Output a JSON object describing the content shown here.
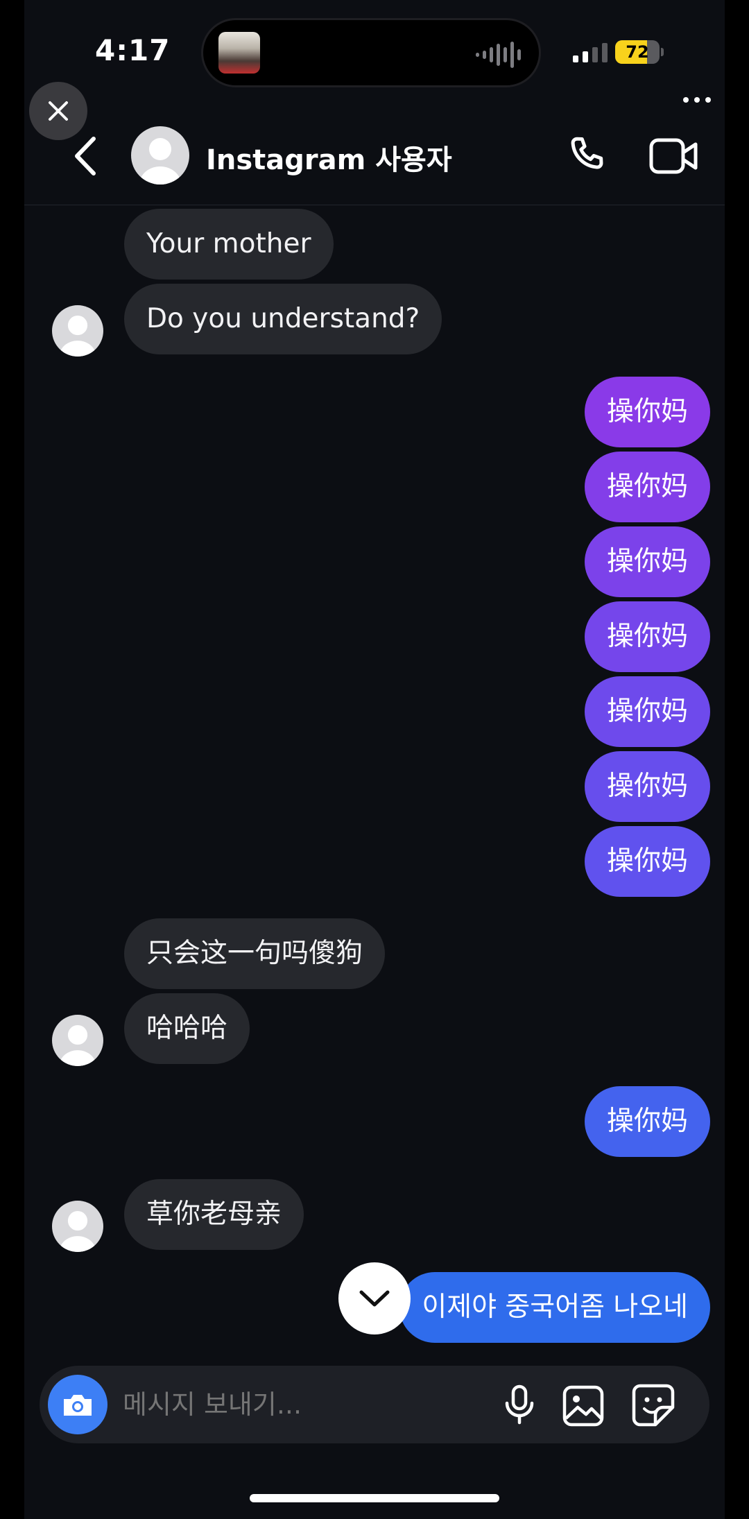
{
  "status_bar": {
    "time": "4:17",
    "battery_level": "72",
    "battery_fraction": 0.72
  },
  "header": {
    "name": "Instagram 사용자",
    "icons": [
      "back-icon",
      "phone-icon",
      "video-camera-icon",
      "close-icon",
      "more-icon"
    ]
  },
  "messages": [
    {
      "side": "in",
      "text": "Your mother"
    },
    {
      "side": "in",
      "text": "Do you understand?"
    },
    {
      "side": "out",
      "text": "操你妈",
      "color": "#8a3ae8"
    },
    {
      "side": "out",
      "text": "操你妈",
      "color": "#833ee9"
    },
    {
      "side": "out",
      "text": "操你妈",
      "color": "#7c42ea"
    },
    {
      "side": "out",
      "text": "操你妈",
      "color": "#7546eb"
    },
    {
      "side": "out",
      "text": "操你妈",
      "color": "#6e4aec"
    },
    {
      "side": "out",
      "text": "操你妈",
      "color": "#674eed"
    },
    {
      "side": "out",
      "text": "操你妈",
      "color": "#6052ee"
    },
    {
      "side": "in",
      "text": "只会这一句吗傻狗"
    },
    {
      "side": "in",
      "text": "哈哈哈"
    },
    {
      "side": "out",
      "text": "操你妈",
      "color": "#4463ee"
    },
    {
      "side": "in",
      "text": "草你老母亲"
    },
    {
      "side": "out",
      "text": "이제야 중국어좀 나오네",
      "color": "#2f6cec"
    }
  ],
  "composer": {
    "placeholder": "메시지 보내기...",
    "icons": [
      "camera-icon",
      "microphone-icon",
      "gallery-icon",
      "sticker-icon"
    ]
  },
  "colors": {
    "background": "#0c0e13",
    "incoming_bubble": "#26282d",
    "camera_button": "#3d7ff5",
    "battery": "#f8d21c"
  }
}
